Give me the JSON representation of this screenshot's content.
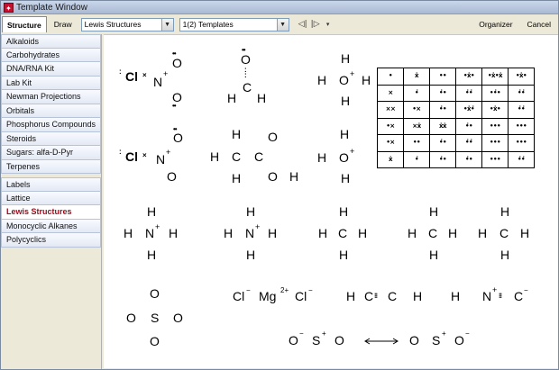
{
  "window": {
    "title": "Template Window",
    "app_icon": "app-icon"
  },
  "toolbar": {
    "structure_tab": "Structure",
    "draw_tab": "Draw",
    "category_value": "Lewis Structures",
    "template_value": "1(2) Templates",
    "organizer_label": "Organizer",
    "cancel_label": "Cancel",
    "icons": [
      "align-left-icon",
      "align-right-icon",
      "dropdown-small-icon"
    ]
  },
  "sidebar": {
    "items": [
      {
        "label": "Alkaloids"
      },
      {
        "label": "Carbohydrates"
      },
      {
        "label": "DNA/RNA Kit"
      },
      {
        "label": "Lab Kit"
      },
      {
        "label": "Newman Projections"
      },
      {
        "label": "Orbitals"
      },
      {
        "label": "Phosphorus Compounds"
      },
      {
        "label": "Steroids"
      },
      {
        "label": "Sugars: alfa-D-Pyr"
      },
      {
        "label": "Terpenes"
      },
      {
        "label": "Labels"
      },
      {
        "label": "Lattice"
      },
      {
        "label": "Lewis Structures",
        "selected": true
      },
      {
        "label": "Monocyclic Alkanes"
      },
      {
        "label": "Polycyclics"
      }
    ]
  },
  "structures": {
    "cl": "Cl",
    "n_plus": "N",
    "plus": "+",
    "o": "O",
    "c": "C",
    "h": "H",
    "n": "N",
    "mg": "Mg",
    "two_plus": "2+",
    "s": "S",
    "minus": "−",
    "c_minus": "C"
  },
  "dot_table": {
    "rows": [
      [
        "•",
        "ẋ",
        "••",
        "•ẋ•",
        "•ẋ•ẋ",
        "•ẋ•"
      ],
      [
        "×",
        "•̇",
        "•̇•",
        "•̇•̇",
        "••̇•",
        "•̇•̇"
      ],
      [
        "××",
        "•×",
        "•̇•",
        "•ẋ•̇",
        "•ẋ•",
        "•̇•̇"
      ],
      [
        "•×",
        "×ẋ",
        "ẋẋ",
        "•̇•",
        "•••",
        "•••"
      ],
      [
        "•×",
        "••",
        "•̇•",
        "•̇•̇",
        "•••",
        "•••"
      ],
      [
        "ẋ",
        "•̇",
        "•̇•",
        "•̇•",
        "•••",
        "•̇•̇"
      ]
    ]
  }
}
